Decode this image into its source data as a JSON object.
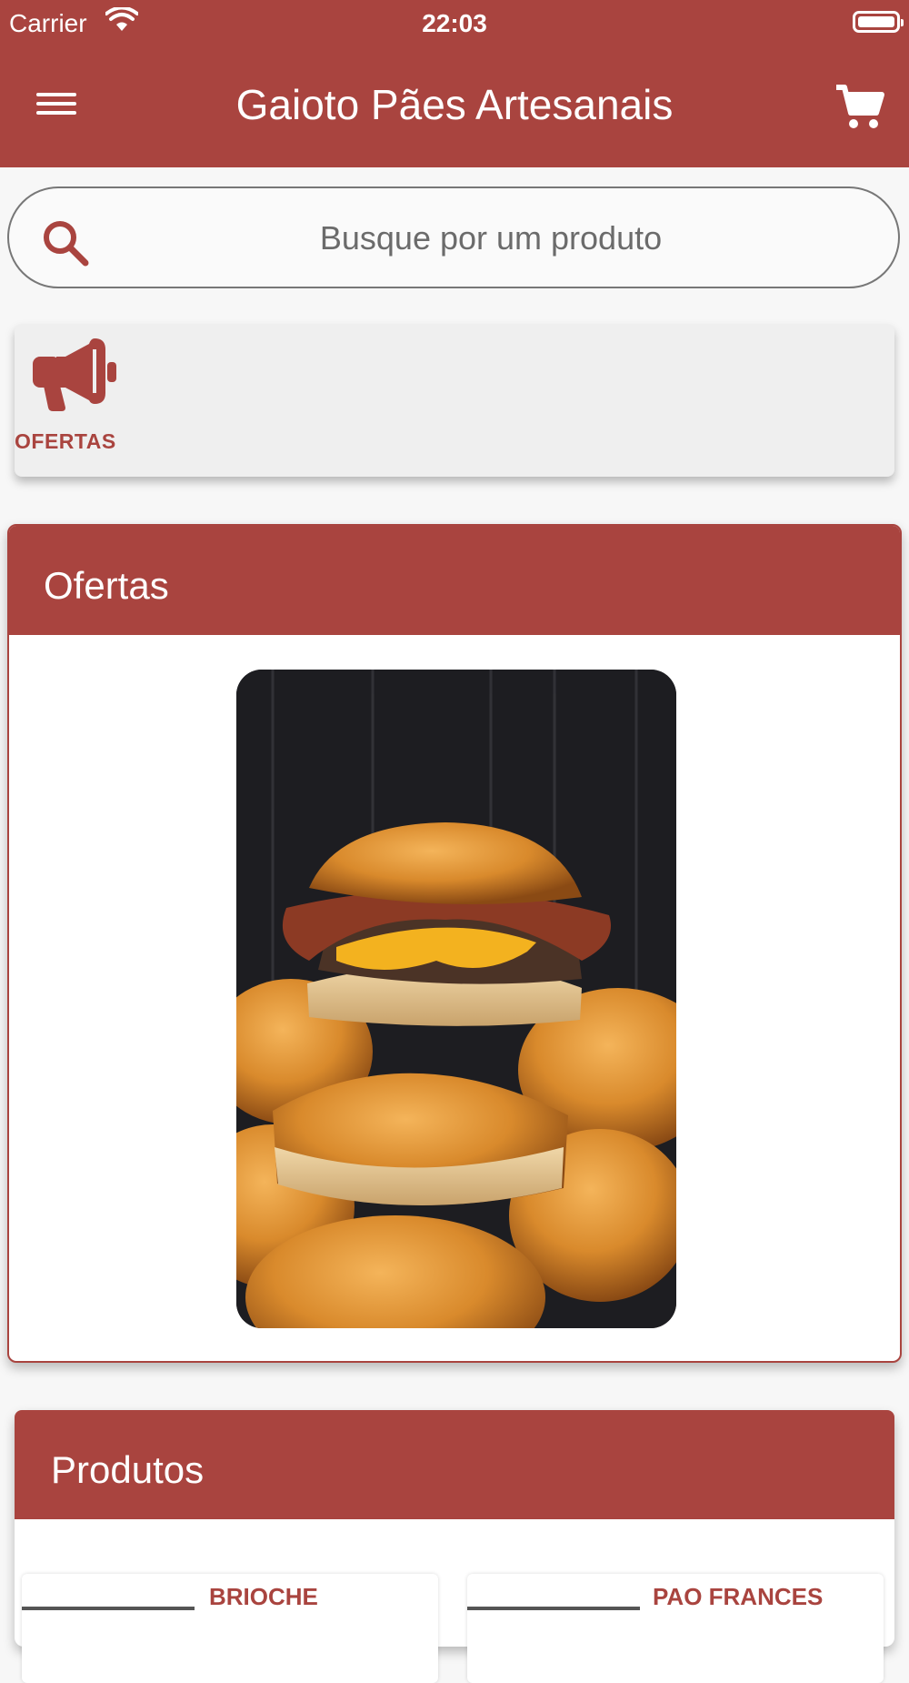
{
  "status_bar": {
    "carrier": "Carrier",
    "time": "22:03"
  },
  "header": {
    "title": "Gaioto Pães Artesanais",
    "menu_icon": "menu-icon",
    "cart_icon": "cart-icon"
  },
  "search": {
    "placeholder": "Busque por um produto",
    "value": ""
  },
  "categories": [
    {
      "label": "OFERTAS",
      "icon": "megaphone-icon"
    }
  ],
  "ofertas_section": {
    "title": "Ofertas",
    "image_alt": "burger-on-brioche-buns"
  },
  "produtos_section": {
    "title": "Produtos",
    "items": [
      {
        "name": "BRIOCHE"
      },
      {
        "name": "PAO FRANCES"
      }
    ]
  },
  "colors": {
    "primary": "#a9443f",
    "background": "#f7f7f7"
  }
}
